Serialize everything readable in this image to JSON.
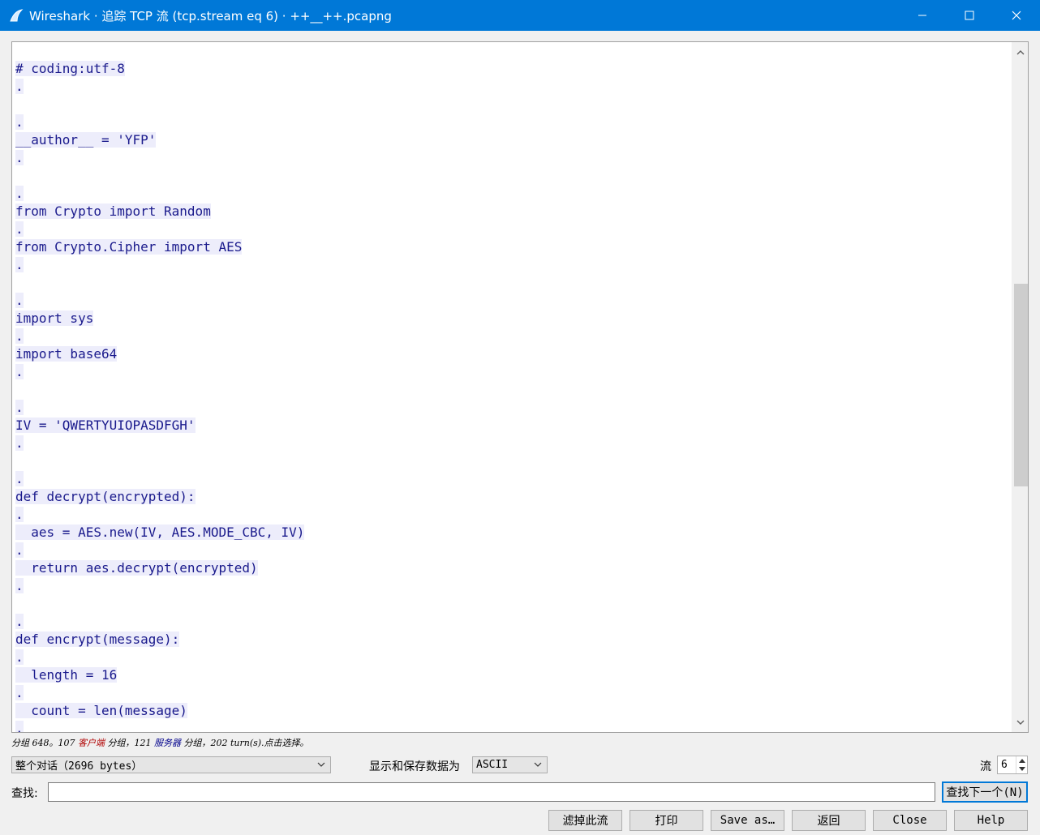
{
  "window": {
    "title": "Wireshark · 追踪 TCP 流 (tcp.stream eq 6) · ++__++.pcapng",
    "icon": "wireshark-fin-icon"
  },
  "stream_lines": [
    "# coding:utf-8",
    ".",
    "",
    ".",
    "__author__ = 'YFP'",
    ".",
    "",
    ".",
    "from Crypto import Random",
    ".",
    "from Crypto.Cipher import AES",
    ".",
    "",
    ".",
    "import sys",
    ".",
    "import base64",
    ".",
    "",
    ".",
    "IV = 'QWERTYUIOPASDFGH'",
    ".",
    "",
    ".",
    "def decrypt(encrypted):",
    ".",
    "  aes = AES.new(IV, AES.MODE_CBC, IV)",
    ".",
    "  return aes.decrypt(encrypted)",
    ".",
    "",
    ".",
    "def encrypt(message):",
    ".",
    "  length = 16",
    ".",
    "  count = len(message)",
    "."
  ],
  "status": {
    "prefix": "分组 648。107 ",
    "client": "客户端",
    "mid": " 分组，121 ",
    "server": "服务器",
    "suffix": " 分组，202 turn(s).点击选择。"
  },
  "conversation_select": {
    "value": "整个对话（2696 bytes）"
  },
  "format_label": "显示和保存数据为",
  "format_select": {
    "value": "ASCII"
  },
  "stream_label": "流",
  "stream_number": "6",
  "find": {
    "label": "查找:",
    "value": ""
  },
  "buttons": {
    "find_next": "查找下一个(N)",
    "filter_out": "滤掉此流",
    "print": "打印",
    "save_as": "Save as…",
    "back": "返回",
    "close": "Close",
    "help": "Help"
  },
  "colors": {
    "titlebar": "#0078d7",
    "client_text": "#1a1a8c",
    "client_bg": "#ededfb"
  }
}
